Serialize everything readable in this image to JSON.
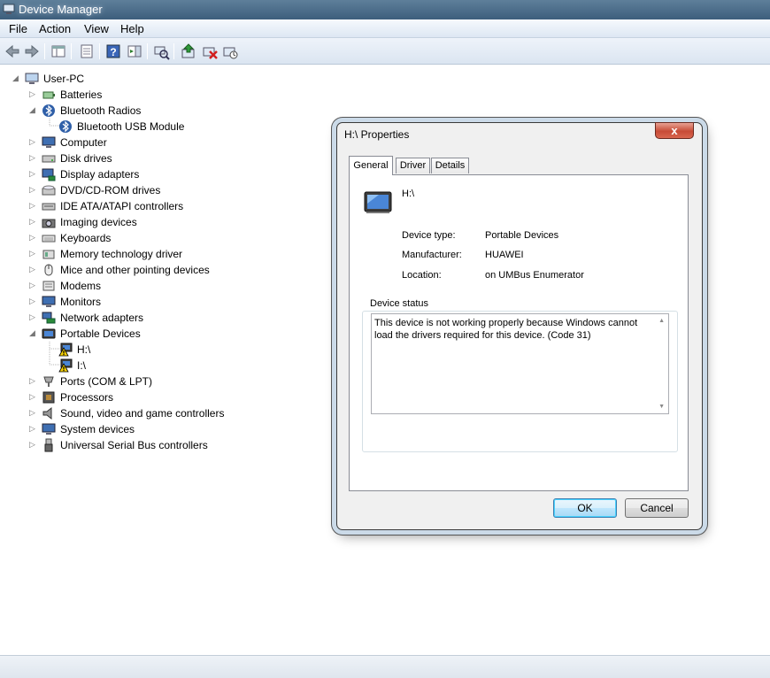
{
  "window": {
    "title": "Device Manager"
  },
  "menu": [
    "File",
    "Action",
    "View",
    "Help"
  ],
  "toolbar": [
    "back-icon",
    "forward-icon",
    "console-tree-icon",
    "properties-icon",
    "help-icon",
    "action-pane-icon",
    "scan-hardware-icon",
    "update-driver-icon",
    "uninstall-icon",
    "disable-icon"
  ],
  "tree": {
    "root": "User-PC",
    "items": [
      "Batteries",
      "Bluetooth Radios",
      "Bluetooth USB Module",
      "Computer",
      "Disk drives",
      "Display adapters",
      "DVD/CD-ROM drives",
      "IDE ATA/ATAPI controllers",
      "Imaging devices",
      "Keyboards",
      "Memory technology driver",
      "Mice and other pointing devices",
      "Modems",
      "Monitors",
      "Network adapters",
      "Portable Devices",
      "H:\\",
      "I:\\",
      "Ports (COM & LPT)",
      "Processors",
      "Sound, video and game controllers",
      "System devices",
      "Universal Serial Bus controllers"
    ]
  },
  "dialog": {
    "title": "H:\\ Properties",
    "close": "x",
    "tabs": [
      "General",
      "Driver",
      "Details"
    ],
    "device_name": "H:\\",
    "device_type_label": "Device type:",
    "device_type": "Portable Devices",
    "manufacturer_label": "Manufacturer:",
    "manufacturer": "HUAWEI",
    "location_label": "Location:",
    "location": "on UMBus Enumerator",
    "status_group": "Device status",
    "status_text": "This device is not working properly because Windows cannot load the drivers required for this device. (Code 31)",
    "ok": "OK",
    "cancel": "Cancel"
  },
  "colors": {
    "warning": "#f5d000",
    "titlebar": "#4a6a88",
    "close": "#c74b36"
  }
}
